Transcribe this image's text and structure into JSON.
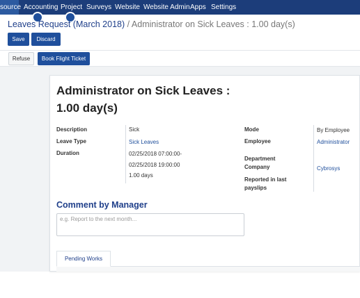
{
  "topnav": {
    "items": [
      "source",
      "Accounting",
      "Project",
      "Surveys",
      "Website",
      "Website Admin",
      "Apps",
      "Settings"
    ]
  },
  "breadcrumb": {
    "parent": "Leaves Request (March 2018)",
    "separator": "/",
    "current": "Administrator on Sick Leaves : 1.00 day(s)"
  },
  "toolbar": {
    "save_label": "Save",
    "discard_label": "Discard"
  },
  "statusbar": {
    "refuse_label": "Refuse",
    "flight_label": "Book Flight Ticket"
  },
  "form": {
    "title": "Administrator on Sick Leaves : 1.00 day(s)",
    "left": {
      "description_label": "Description",
      "description_value": "Sick",
      "leave_type_label": "Leave Type",
      "leave_type_value": "Sick Leaves",
      "duration_label": "Duration",
      "duration_from": "02/25/2018 07:00:00-",
      "duration_to": "02/25/2018 19:00:00",
      "duration_days": "1.00 days"
    },
    "right": {
      "mode_label": "Mode",
      "mode_value": "By Employee",
      "employee_label": "Employee",
      "employee_value": "Administrator",
      "department_label": "Department",
      "company_label": "Company",
      "company_value": "Cybrosys",
      "payslips_label": "Reported in last payslips"
    },
    "comment_title": "Comment by Manager",
    "comment_placeholder": "e.g. Report to the next month...",
    "tab_label": "Pending Works"
  },
  "colors": {
    "topbar": "#1c3d7a",
    "primary": "#1f4f9c",
    "link": "#1f3f8a"
  }
}
